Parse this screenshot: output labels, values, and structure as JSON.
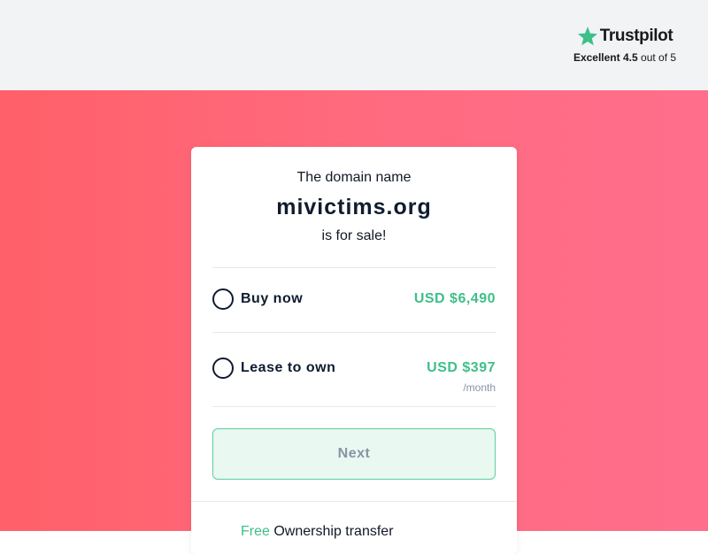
{
  "trustpilot": {
    "brand": "Trustpilot",
    "rating_word": "Excellent",
    "score": "4.5",
    "out_of": "out of 5",
    "star_color": "#00b67a"
  },
  "card": {
    "intro": "The domain name",
    "domain": "mivictims.org",
    "status": "is for sale!"
  },
  "options": [
    {
      "label": "Buy now",
      "price": "USD $6,490",
      "selected": false
    },
    {
      "label": "Lease to own",
      "price": "USD $397",
      "period": "/month",
      "selected": false
    }
  ],
  "next_button": {
    "label": "Next"
  },
  "features": [
    {
      "accent": "Free",
      "text": "Ownership transfer"
    }
  ],
  "colors": {
    "accent_green": "#3ebf8a",
    "hero_gradient_start": "#ff6069",
    "hero_gradient_end": "#ff6e8b",
    "text_dark": "#0f1c2e",
    "topbar_bg": "#f1f3f5"
  }
}
